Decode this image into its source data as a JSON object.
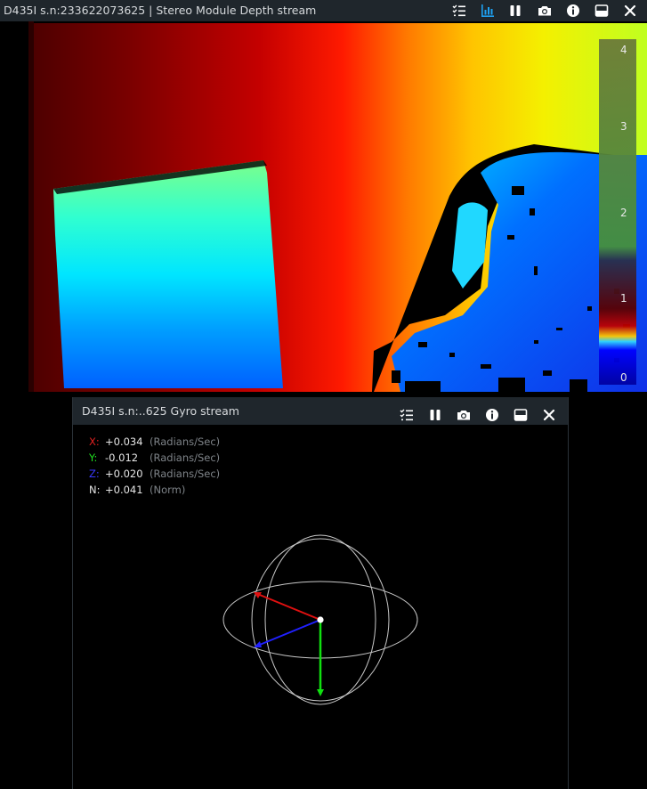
{
  "depth_window": {
    "title": "D435I s.n:233622073625 | Stereo Module Depth stream",
    "toolbar_icons": [
      "options-checklist-icon",
      "metrics-chart-icon",
      "pause-icon",
      "snapshot-camera-icon",
      "info-icon",
      "minimize-window-icon",
      "close-icon"
    ],
    "colorbar_ticks": [
      "4",
      "3",
      "2",
      "1",
      "0"
    ],
    "colors": {
      "titlebar_bg": "#1f262c",
      "active_icon": "#1ea1f2",
      "icon": "#ffffff"
    }
  },
  "gyro_window": {
    "title": "D435I s.n:..625 Gyro stream",
    "toolbar_icons": [
      "options-checklist-icon",
      "pause-icon",
      "snapshot-camera-icon",
      "info-icon",
      "minimize-window-icon",
      "close-icon"
    ],
    "readouts": [
      {
        "axis": "X:",
        "value": "+0.034",
        "unit": "(Radians/Sec)",
        "color": "#e02020"
      },
      {
        "axis": "Y:",
        "value": "-0.012",
        "unit": "(Radians/Sec)",
        "color": "#20e020"
      },
      {
        "axis": "Z:",
        "value": "+0.020",
        "unit": "(Radians/Sec)",
        "color": "#3a3aff"
      },
      {
        "axis": "N:",
        "value": "+0.041",
        "unit": "(Norm)",
        "color": "#e6e6e6"
      }
    ]
  }
}
